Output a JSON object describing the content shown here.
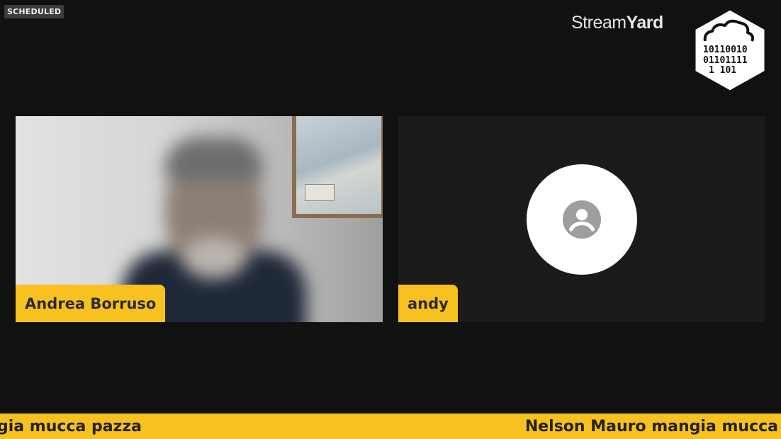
{
  "status": {
    "badge": "SCHEDULED"
  },
  "brand": {
    "name_light": "Stream",
    "name_bold": "Yard"
  },
  "logo": {
    "icon": "cloud-binary-hexagon-logo",
    "binary_lines": [
      "10110010",
      "01101111",
      "1 101"
    ]
  },
  "participants": [
    {
      "name": "Andrea Borruso",
      "video": "camera-feed"
    },
    {
      "name": "andy",
      "video": "no-video",
      "avatar_icon": "person-icon"
    }
  ],
  "ticker": {
    "left_text": "gia mucca pazza",
    "right_text": "Nelson Mauro mangia mucca"
  },
  "colors": {
    "background": "#111111",
    "accent": "#f7c21f",
    "tile_empty": "#1b1b1b",
    "avatar_bg": "#ffffff",
    "avatar_icon": "#9e9e9e"
  }
}
